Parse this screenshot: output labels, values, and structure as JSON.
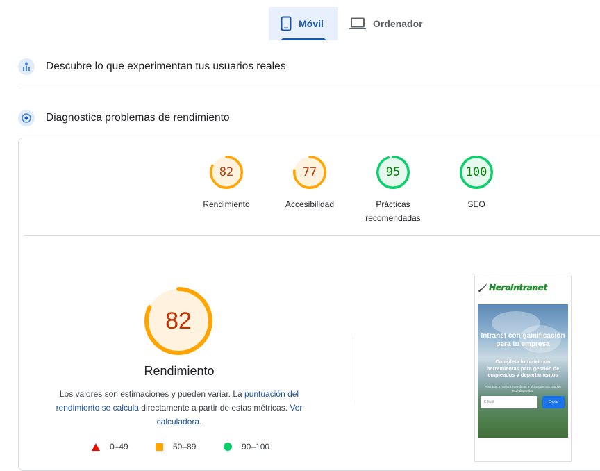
{
  "tabs": {
    "mobile": {
      "label": "Móvil",
      "icon": "smartphone-icon"
    },
    "desktop": {
      "label": "Ordenador",
      "icon": "laptop-icon"
    }
  },
  "sections": {
    "real_users": {
      "label": "Descubre lo que experimentan tus usuarios reales",
      "icon": "users-chart-icon"
    },
    "diagnose": {
      "label": "Diagnostica problemas de rendimiento",
      "icon": "diagnostics-icon"
    }
  },
  "scores": [
    {
      "value": "82",
      "fraction": 0.82,
      "label": "Rendimiento",
      "color": "#ffa400",
      "bg": "#fff3e0",
      "text_color": "#c33300"
    },
    {
      "value": "77",
      "fraction": 0.77,
      "label": "Accesibilidad",
      "color": "#ffa400",
      "bg": "#fff3e0",
      "text_color": "#c33300"
    },
    {
      "value": "95",
      "fraction": 0.95,
      "label": "Prácticas recomendadas",
      "color": "#0cce6b",
      "bg": "#e6f9ee",
      "text_color": "#008800"
    },
    {
      "value": "100",
      "fraction": 1.0,
      "label": "SEO",
      "color": "#0cce6b",
      "bg": "#e6f9ee",
      "text_color": "#008800"
    }
  ],
  "performance": {
    "value": "82",
    "fraction": 0.82,
    "title": "Rendimiento",
    "desc_part1": "Los valores son estimaciones y pueden variar. La ",
    "desc_link1": "puntuación del rendimiento se calcula",
    "desc_part2": " directamente a partir de estas métricas. ",
    "desc_link2": "Ver calculadora",
    "desc_part3": "."
  },
  "legend": [
    {
      "range": "0–49",
      "color": "#eb0f00"
    },
    {
      "range": "50–89",
      "color": "#ffa400"
    },
    {
      "range": "90–100",
      "color": "#0cce6b"
    }
  ],
  "screenshot": {
    "logo": "HeroIntranet",
    "headline": "Intranet con gamificación para tu empresa",
    "subhead": "Completa intranet con herramientas para gestión de empleados y departamentos",
    "small_text": "Apúntate a nuestra Newsletter y te avisaremos cuando esté disponible",
    "email_placeholder": "E-Mail",
    "send_label": "Enviar"
  }
}
